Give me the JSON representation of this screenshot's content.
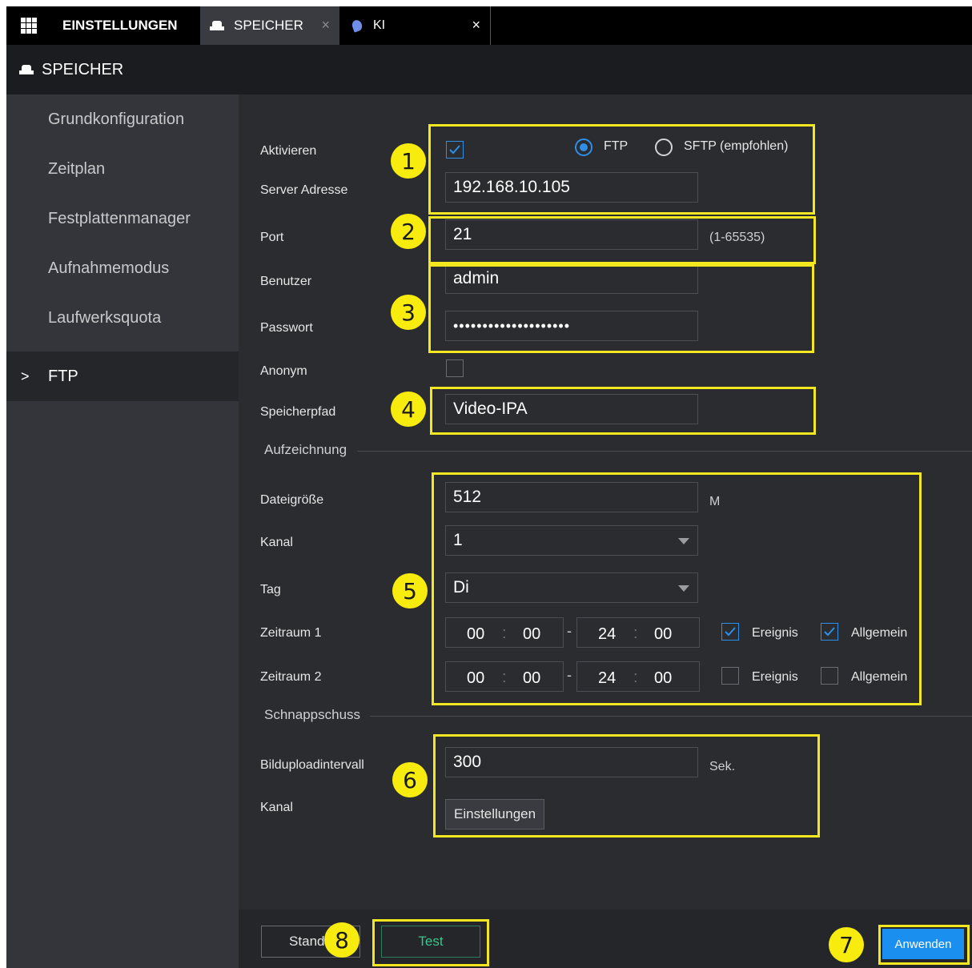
{
  "tabs": {
    "settings": "EINSTELLUNGEN",
    "storage": "SPEICHER",
    "ki": "KI",
    "close": "×"
  },
  "title": "SPEICHER",
  "sidebar": {
    "chevron": ">",
    "items": [
      {
        "label": "Grundkonfiguration"
      },
      {
        "label": "Zeitplan"
      },
      {
        "label": "Festplattenmanager"
      },
      {
        "label": "Aufnahmemodus"
      },
      {
        "label": "Laufwerksquota"
      },
      {
        "label": "FTP"
      }
    ]
  },
  "form": {
    "enable_label": "Aktivieren",
    "protocol_ftp": "FTP",
    "protocol_sftp": "SFTP (empfohlen)",
    "server_label": "Server Adresse",
    "server_value": "192.168.10.105",
    "port_label": "Port",
    "port_value": "21",
    "port_range": "(1-65535)",
    "user_label": "Benutzer",
    "user_value": "admin",
    "password_label": "Passwort",
    "password_value": "••••••••••••••••••••",
    "anonymous_label": "Anonym",
    "path_label": "Speicherpfad",
    "path_value": "Video-IPA"
  },
  "recording": {
    "section_title": "Aufzeichnung",
    "filesize_label": "Dateigröße",
    "filesize_value": "512",
    "filesize_unit": "M",
    "channel_label": "Kanal",
    "channel_value": "1",
    "day_label": "Tag",
    "day_value": "Di",
    "period1_label": "Zeitraum 1",
    "period2_label": "Zeitraum 2",
    "colon": ":",
    "dash": "-",
    "time_start_h": "00",
    "time_start_m": "00",
    "time_end_h": "24",
    "time_end_m": "00",
    "event_label": "Ereignis",
    "general_label": "Allgemein"
  },
  "snapshot": {
    "section_title": "Schnappschuss",
    "interval_label": "Bilduploadintervall",
    "interval_value": "300",
    "interval_unit": "Sek.",
    "channel_label": "Kanal",
    "settings_button": "Einstellungen"
  },
  "footer": {
    "default_button": "Standa",
    "test_button": "Test",
    "apply_button": "Anwenden"
  },
  "annotations": [
    "1",
    "2",
    "3",
    "4",
    "5",
    "6",
    "7",
    "8"
  ],
  "colors": {
    "accent_blue": "#1a8ff0",
    "highlight_yellow": "#f3e722",
    "test_green": "#3ec28a"
  }
}
